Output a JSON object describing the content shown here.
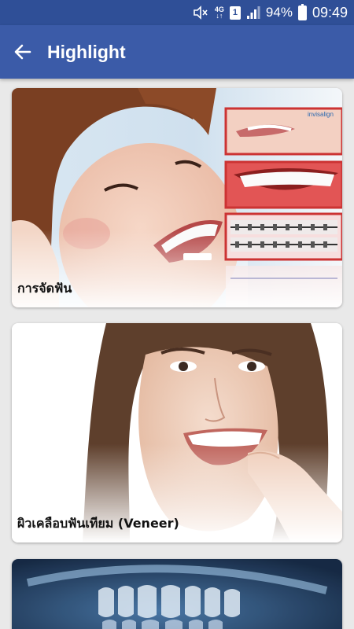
{
  "status_bar": {
    "network": "4G",
    "sim_slot": "1",
    "battery_percent": "94%",
    "battery_level": 0.94,
    "time": "09:49",
    "icons": [
      "mute-icon",
      "network-icon",
      "sim-icon",
      "signal-icon",
      "battery-icon"
    ]
  },
  "app_bar": {
    "back_icon": "arrow-left-icon",
    "title": "Highlight"
  },
  "cards": [
    {
      "title": "การจัดฟัน",
      "image": "smiling woman with braces and invisalign inset photos",
      "brand_mark": "invisalign"
    },
    {
      "title": "ผิวเคลือบฟันเทียม (Veneer)",
      "image": "smiling woman with white teeth"
    },
    {
      "title": "",
      "image": "dental x-ray teeth"
    }
  ],
  "colors": {
    "status_bar": "#2f4f97",
    "app_bar": "#3b5ba8",
    "background": "#e9e9e9"
  }
}
